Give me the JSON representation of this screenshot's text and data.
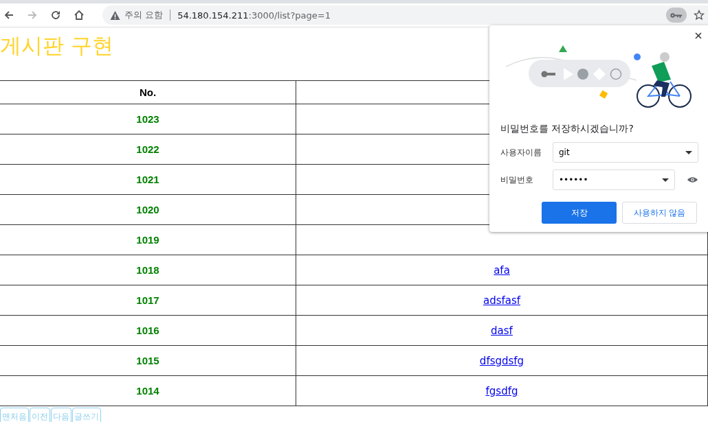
{
  "browser": {
    "security_label": "주의 요함",
    "url_host": "54.180.154.211",
    "url_rest": ":3000/list?page=1",
    "back_disabled": false,
    "forward_disabled": true
  },
  "page": {
    "title": "게시판 구현"
  },
  "table": {
    "columns": [
      "No."
    ],
    "rows": [
      {
        "no": "1023"
      },
      {
        "no": "1022"
      },
      {
        "no": "1021"
      },
      {
        "no": "1020"
      },
      {
        "no": "1019"
      },
      {
        "no": "1018",
        "title": "afa"
      },
      {
        "no": "1017",
        "title": "adsfasf"
      },
      {
        "no": "1016",
        "title": "dasf"
      },
      {
        "no": "1015",
        "title": "dfsgdsfg"
      },
      {
        "no": "1014",
        "title": "fgsdfg"
      }
    ]
  },
  "pager": [
    "맨처음",
    "이전",
    "다음",
    "글쓰기"
  ],
  "password_popup": {
    "heading": "비밀번호를 저장하시겠습니까?",
    "username_label": "사용자이름",
    "username": "git",
    "password_label": "비밀번호",
    "password": "••••••",
    "save_button": "저장",
    "never_button": "사용하지 않음"
  }
}
